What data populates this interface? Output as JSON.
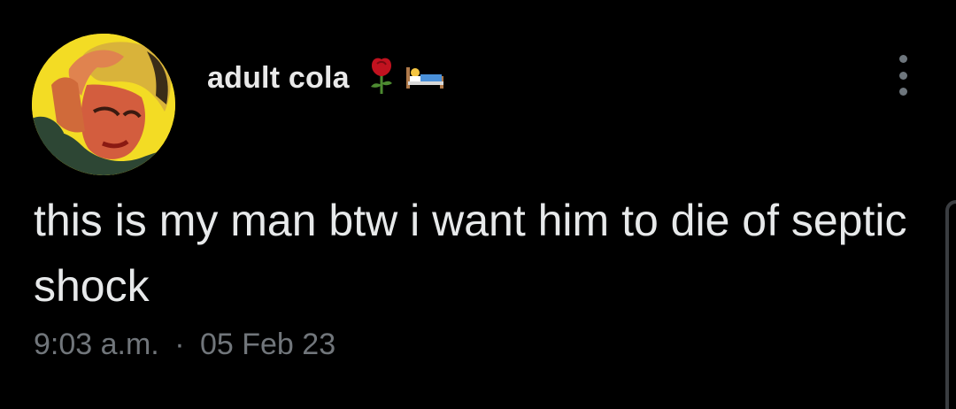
{
  "tweet": {
    "author": {
      "display_name": "adult cola",
      "avatar": "avatar-comic-man-icon",
      "name_emojis": [
        "rose-icon",
        "bed-icon"
      ]
    },
    "text": "this is my man btw i want him to die of septic shock",
    "time": "9:03 a.m.",
    "separator": "·",
    "date": "05 Feb 23"
  },
  "icons": {
    "more_options": "more-vertical-icon"
  },
  "colors": {
    "background": "#000000",
    "primary_text": "#e7e9ea",
    "secondary_text": "#71767b",
    "avatar_bg": "#f3dc24"
  }
}
